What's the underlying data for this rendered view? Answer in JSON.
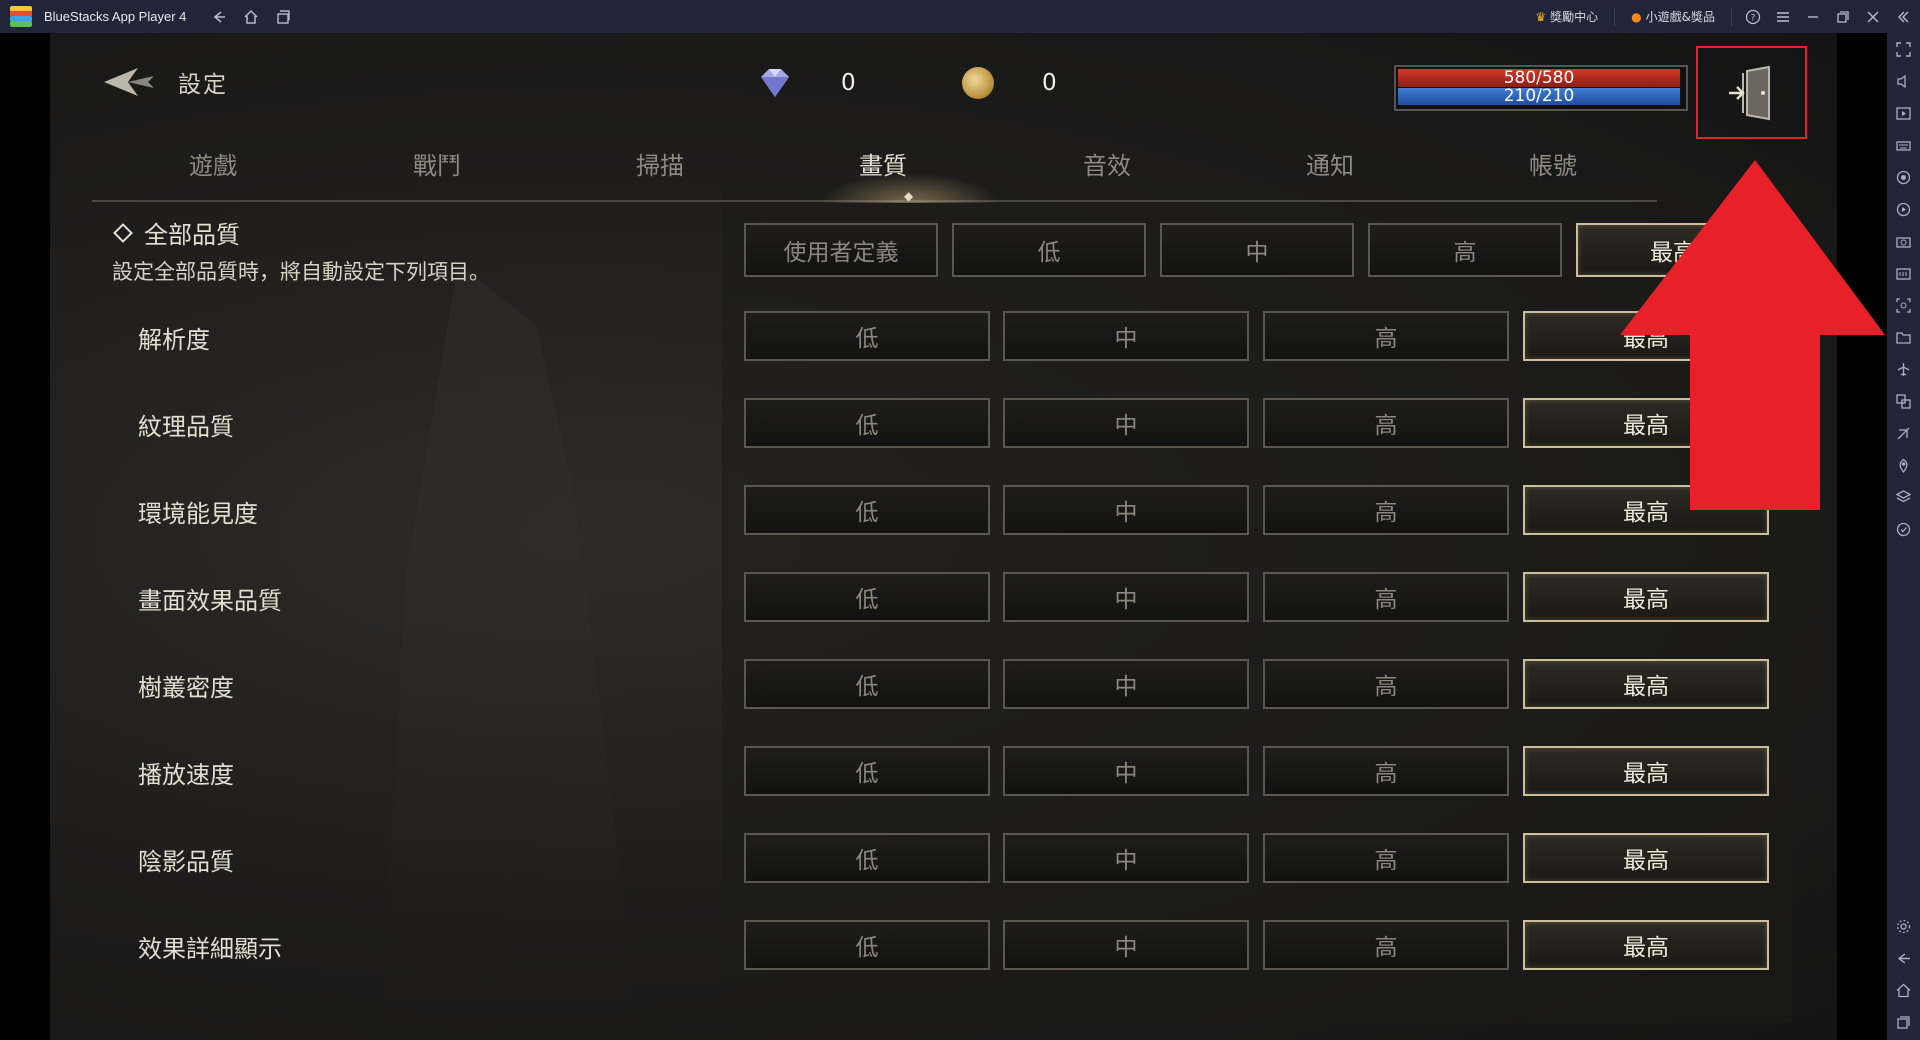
{
  "window": {
    "app_title": "BlueStacks App Player 4",
    "links": [
      {
        "label": "獎勵中心",
        "icon": "crown-icon"
      },
      {
        "label": "小遊戲&獎品",
        "icon": "coin-icon"
      }
    ]
  },
  "header": {
    "title": "設定",
    "diamonds": "0",
    "gold": "0",
    "hp": "580/580",
    "mp": "210/210"
  },
  "tabs": [
    "遊戲",
    "戰鬥",
    "掃描",
    "畫質",
    "音效",
    "通知",
    "帳號"
  ],
  "active_tab": "畫質",
  "all_quality": {
    "title": "全部品質",
    "description": "設定全部品質時，將自動設定下列項目。",
    "options": [
      "使用者定義",
      "低",
      "中",
      "高",
      "最高"
    ],
    "selected": "最高"
  },
  "settings": [
    {
      "label": "解析度",
      "options": [
        "低",
        "中",
        "高",
        "最高"
      ],
      "selected": "最高"
    },
    {
      "label": "紋理品質",
      "options": [
        "低",
        "中",
        "高",
        "最高"
      ],
      "selected": "最高"
    },
    {
      "label": "環境能見度",
      "options": [
        "低",
        "中",
        "高",
        "最高"
      ],
      "selected": "最高"
    },
    {
      "label": "畫面效果品質",
      "options": [
        "低",
        "中",
        "高",
        "最高"
      ],
      "selected": "最高"
    },
    {
      "label": "樹叢密度",
      "options": [
        "低",
        "中",
        "高",
        "最高"
      ],
      "selected": "最高"
    },
    {
      "label": "播放速度",
      "options": [
        "低",
        "中",
        "高",
        "最高"
      ],
      "selected": "最高"
    },
    {
      "label": "陰影品質",
      "options": [
        "低",
        "中",
        "高",
        "最高"
      ],
      "selected": "最高"
    },
    {
      "label": "效果詳細顯示",
      "options": [
        "低",
        "中",
        "高",
        "最高"
      ],
      "selected": "最高"
    }
  ],
  "colors": {
    "highlight_box": "#e0262a",
    "arrow": "#e8202a",
    "hp_bar": "#c0352a",
    "mp_bar": "#3a74c9",
    "selected_border": "#cdbd98"
  }
}
